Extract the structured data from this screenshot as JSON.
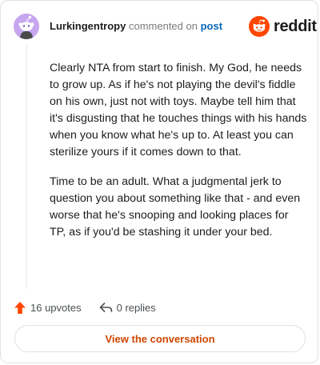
{
  "header": {
    "username": "Lurkingentropy",
    "commented_text": "commented on",
    "post_link": "post"
  },
  "brand": {
    "wordmark": "reddit",
    "accent_color": "#ff4500",
    "avatar_color": "#c6a6ef"
  },
  "comment": {
    "paragraphs": [
      "Clearly NTA from start to finish. My God, he needs to grow up. As if he's not playing the devil's fiddle on his own, just not with toys. Maybe tell him that it's disgusting that he touches things with his hands when you know what he's up to. At least you can sterilize yours if it comes down to that.",
      "Time to be an adult. What a judgmental jerk to question you about something like that - and even worse that he's snooping and looking places for TP, as if you'd be stashing it under your bed."
    ]
  },
  "actions": {
    "upvotes_label": "16 upvotes",
    "replies_label": "0 replies"
  },
  "footer": {
    "view_button_label": "View the conversation"
  },
  "icons": {
    "upvote": "upvote-arrow-icon",
    "reply": "reply-arrow-icon",
    "logo": "reddit-snoo-icon",
    "avatar": "snoo-avatar-icon"
  }
}
